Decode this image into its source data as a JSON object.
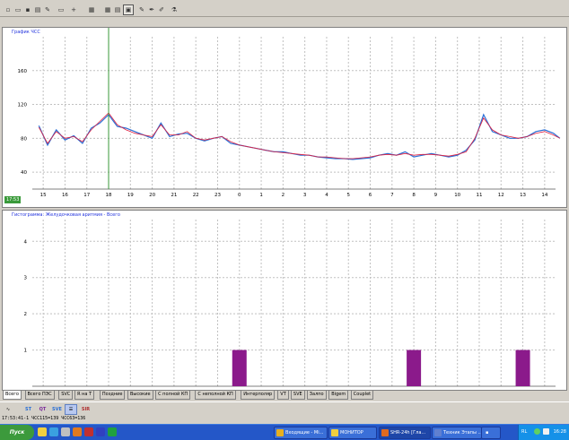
{
  "toolbar": {
    "icons": [
      "new-icon",
      "open-icon",
      "save-icon",
      "print-icon",
      "paint-icon",
      "rect-icon",
      "plus-icon",
      "table-icon",
      "grid-icon",
      "list-icon",
      "window-icon",
      "edit-icon",
      "pen-icon",
      "brush-icon",
      "flask-icon"
    ]
  },
  "top_panel": {
    "title": "График ЧСС",
    "time_badge": "17:53"
  },
  "bottom_panel": {
    "title": "Гистограмма: Желудочковая аритмия - Всего"
  },
  "tabs": [
    "Всего",
    "Всего ПЭС",
    "SVC",
    "R на T",
    "Поздние",
    "Высокие",
    "С полной КП",
    "С неполной КП",
    "Интерполяр",
    "VT",
    "SVE",
    "Залпо",
    "Bigem",
    "Couplet"
  ],
  "active_tab": 0,
  "bottom_toolbar": {
    "buttons": [
      "ST",
      "QT",
      "SVE",
      "SIR"
    ]
  },
  "status_line": "17:53:41-1 ЧСС115=139 ЧСС63=136",
  "taskbar": {
    "start_label": "Пуск",
    "items": [
      "Входящие - Mi...",
      "МОНИТОР",
      "SHR-24h [Гла...",
      "Техник Этапы ..."
    ],
    "active_item": 2,
    "tray_lang": "RL",
    "clock": "16:28"
  },
  "chart_data": [
    {
      "type": "line",
      "title": "График ЧСС",
      "x_tick_labels": [
        "15",
        "16",
        "17",
        "18",
        "19",
        "20",
        "21",
        "22",
        "23",
        "0",
        "1",
        "2",
        "3",
        "4",
        "5",
        "6",
        "7",
        "8",
        "9",
        "10",
        "11",
        "12",
        "13",
        "14"
      ],
      "y_tick_labels": [
        "40",
        "80",
        "120",
        "160"
      ],
      "ylim": [
        20,
        200
      ],
      "grid": true,
      "cursor_hour": "18",
      "series": [
        {
          "color": "#2a6fd6",
          "x": [
            14.8,
            15.2,
            15.6,
            16.0,
            16.4,
            16.8,
            17.2,
            17.6,
            18.0,
            18.4,
            18.8,
            19.2,
            19.6,
            20.0,
            20.4,
            20.8,
            21.2,
            21.6,
            22.0,
            22.4,
            22.8,
            23.2,
            23.6,
            24.0,
            24.4,
            24.8,
            25.2,
            25.6,
            26.0,
            26.4,
            26.8,
            27.2,
            27.6,
            28.0,
            28.4,
            28.8,
            29.2,
            29.6,
            30.0,
            30.4,
            30.8,
            31.2,
            31.6,
            32.0,
            32.4,
            32.8,
            33.2,
            33.6,
            34.0,
            34.4,
            34.8,
            35.2,
            35.6,
            36.0,
            36.4,
            36.8,
            37.2,
            37.6,
            38.0,
            38.4,
            38.7
          ],
          "y": [
            95,
            72,
            90,
            78,
            83,
            74,
            92,
            98,
            108,
            94,
            92,
            88,
            84,
            80,
            98,
            82,
            85,
            86,
            80,
            77,
            80,
            82,
            74,
            72,
            70,
            68,
            66,
            64,
            64,
            62,
            60,
            60,
            58,
            57,
            56,
            56,
            55,
            56,
            57,
            60,
            62,
            60,
            64,
            58,
            60,
            62,
            60,
            58,
            60,
            66,
            78,
            108,
            88,
            84,
            80,
            80,
            82,
            88,
            90,
            86,
            80
          ]
        },
        {
          "color": "#e02040",
          "x": [
            14.8,
            15.2,
            15.6,
            16.0,
            16.4,
            16.8,
            17.2,
            17.6,
            18.0,
            18.4,
            18.8,
            19.2,
            19.6,
            20.0,
            20.4,
            20.8,
            21.2,
            21.6,
            22.0,
            22.4,
            22.8,
            23.2,
            23.6,
            24.0,
            24.4,
            24.8,
            25.2,
            25.6,
            26.0,
            26.4,
            26.8,
            27.2,
            27.6,
            28.0,
            28.4,
            28.8,
            29.2,
            29.6,
            30.0,
            30.4,
            30.8,
            31.2,
            31.6,
            32.0,
            32.4,
            32.8,
            33.2,
            33.6,
            34.0,
            34.4,
            34.8,
            35.2,
            35.6,
            36.0,
            36.4,
            36.8,
            37.2,
            37.6,
            38.0,
            38.4,
            38.7
          ],
          "y": [
            93,
            74,
            88,
            80,
            82,
            76,
            90,
            100,
            110,
            96,
            90,
            86,
            84,
            82,
            96,
            84,
            84,
            88,
            80,
            78,
            80,
            82,
            76,
            72,
            70,
            68,
            66,
            64,
            63,
            62,
            61,
            60,
            58,
            58,
            57,
            56,
            56,
            57,
            58,
            60,
            61,
            60,
            62,
            60,
            61,
            61,
            60,
            59,
            61,
            64,
            80,
            104,
            90,
            84,
            82,
            80,
            82,
            86,
            88,
            84,
            80
          ]
        }
      ]
    },
    {
      "type": "bar",
      "title": "Гистограмма: Желудочковая аритмия - Всего",
      "x_tick_labels": [
        "15",
        "16",
        "17",
        "18",
        "19",
        "20",
        "21",
        "22",
        "23",
        "0",
        "1",
        "2",
        "3",
        "4",
        "5",
        "6",
        "7",
        "8",
        "9",
        "10",
        "11",
        "12",
        "13",
        "14"
      ],
      "y_tick_labels": [
        "1",
        "2",
        "3",
        "4"
      ],
      "ylim": [
        0,
        4.6
      ],
      "grid": true,
      "bars": [
        {
          "hour": "0",
          "value": 1
        },
        {
          "hour": "8",
          "value": 1
        },
        {
          "hour": "13",
          "value": 1
        }
      ],
      "bar_color": "#8b1a8b"
    }
  ]
}
